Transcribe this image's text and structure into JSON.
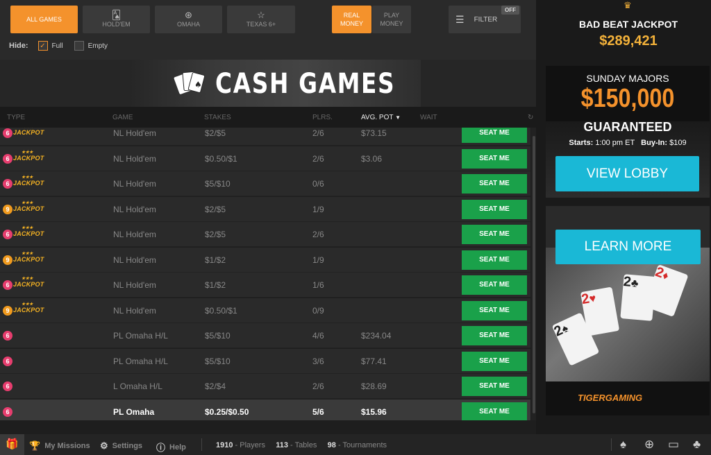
{
  "filters": {
    "game_buttons": [
      {
        "label": "ALL GAMES",
        "icon": "",
        "active": true
      },
      {
        "label": "HOLD'EM",
        "icon": "cards-icon",
        "active": false
      },
      {
        "label": "OMAHA",
        "icon": "omaha-icon",
        "active": false
      },
      {
        "label": "TEXAS 6+",
        "icon": "star-icon",
        "active": false
      }
    ],
    "money": {
      "real": "REAL MONEY",
      "play": "PLAY MONEY"
    },
    "filter_label": "FILTER",
    "filter_state": "OFF",
    "hide_label": "Hide:",
    "hide_full": "Full",
    "hide_empty": "Empty"
  },
  "banner": {
    "title": "CASH GAMES"
  },
  "table": {
    "headers": {
      "type": "TYPE",
      "game": "GAME",
      "stakes": "STAKES",
      "plrs": "PLRS.",
      "pot": "AVG. POT",
      "wait": "WAIT"
    },
    "rows": [
      {
        "seats": "6",
        "jackpot": "JACKPOT",
        "game": "NL Hold'em",
        "stakes": "$2/$5",
        "plrs": "2/6",
        "pot": "$73.15",
        "seat_label": "SEAT ME",
        "partial": true
      },
      {
        "seats": "6",
        "jackpot": "JACKPOT",
        "game": "NL Hold'em",
        "stakes": "$0.50/$1",
        "plrs": "2/6",
        "pot": "$3.06",
        "seat_label": "SEAT ME"
      },
      {
        "seats": "6",
        "jackpot": "JACKPOT",
        "game": "NL Hold'em",
        "stakes": "$5/$10",
        "plrs": "0/6",
        "pot": "",
        "seat_label": "SEAT ME"
      },
      {
        "seats": "9",
        "jackpot": "JACKPOT",
        "game": "NL Hold'em",
        "stakes": "$2/$5",
        "plrs": "1/9",
        "pot": "",
        "seat_label": "SEAT ME"
      },
      {
        "seats": "6",
        "jackpot": "JACKPOT",
        "game": "NL Hold'em",
        "stakes": "$2/$5",
        "plrs": "2/6",
        "pot": "",
        "seat_label": "SEAT ME"
      },
      {
        "seats": "9",
        "jackpot": "JACKPOT",
        "game": "NL Hold'em",
        "stakes": "$1/$2",
        "plrs": "1/9",
        "pot": "",
        "seat_label": "SEAT ME"
      },
      {
        "seats": "6",
        "jackpot": "JACKPOT",
        "game": "NL Hold'em",
        "stakes": "$1/$2",
        "plrs": "1/6",
        "pot": "",
        "seat_label": "SEAT ME"
      },
      {
        "seats": "9",
        "jackpot": "JACKPOT",
        "game": "NL Hold'em",
        "stakes": "$0.50/$1",
        "plrs": "0/9",
        "pot": "",
        "seat_label": "SEAT ME"
      },
      {
        "seats": "6",
        "jackpot": "",
        "game": "PL Omaha H/L",
        "stakes": "$5/$10",
        "plrs": "4/6",
        "pot": "$234.04",
        "seat_label": "SEAT ME"
      },
      {
        "seats": "6",
        "jackpot": "",
        "game": "PL Omaha H/L",
        "stakes": "$5/$10",
        "plrs": "3/6",
        "pot": "$77.41",
        "seat_label": "SEAT ME"
      },
      {
        "seats": "6",
        "jackpot": "",
        "game": "L Omaha H/L",
        "stakes": "$2/$4",
        "plrs": "2/6",
        "pot": "$28.69",
        "seat_label": "SEAT ME"
      },
      {
        "seats": "6",
        "jackpot": "",
        "game": "PL Omaha",
        "stakes": "$0.25/$0.50",
        "plrs": "5/6",
        "pot": "$15.96",
        "seat_label": "SEAT ME",
        "selected": true
      }
    ]
  },
  "jackpot": {
    "title": "BAD BEAT JACKPOT",
    "amount": "$289,421"
  },
  "promo1": {
    "subtitle": "SUNDAY MAJORS",
    "amount": "$150,000",
    "guaranteed": "GUARANTEED",
    "starts_label": "Starts:",
    "starts_value": "1:00 pm ET",
    "buyin_label": "Buy-In:",
    "buyin_value": "$109",
    "button": "VIEW LOBBY"
  },
  "promo2": {
    "button": "LEARN MORE",
    "logo": "TIGERGAMING"
  },
  "bottom": {
    "missions": "My Missions",
    "settings": "Settings",
    "help": "Help",
    "players_count": "1910",
    "players_label": "Players",
    "tables_count": "113",
    "tables_label": "Tables",
    "tournaments_count": "98",
    "tournaments_label": "Tournaments"
  },
  "colors": {
    "accent": "#f4922c",
    "seat": "#1aa14a",
    "cyan": "#1ab8d6",
    "gold": "#f4b23a"
  }
}
